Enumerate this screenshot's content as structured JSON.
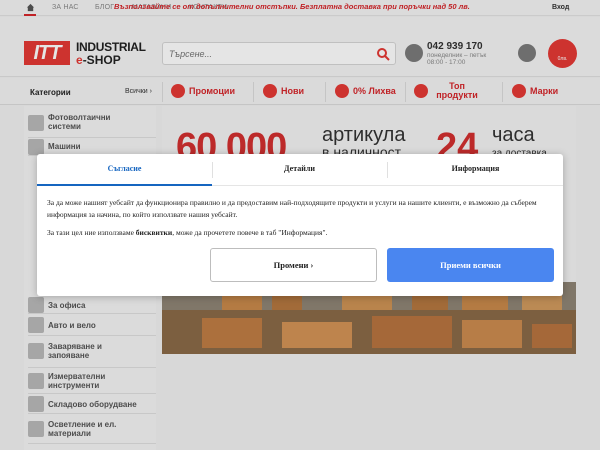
{
  "topbar": {
    "nav": [
      "ЗА НАС",
      "БЛОГ",
      "МАГАЗИНИ",
      "КОНТАКТИ"
    ],
    "promo": "Възползвайте се от допълнителни отстъпки. Безплатна доставка при поръчки над 50 лв.",
    "login": "Вход"
  },
  "header": {
    "logo_mark": "ITT",
    "logo_line1": "INDUSTRIAL",
    "logo_line2_e": "e",
    "logo_line2_rest": "-SHOP",
    "search_placeholder": "Търсене...",
    "phone": "042 939 170",
    "phone_days": "понеделник – петък",
    "phone_hours": "08:00 - 17:00",
    "cart_label": "0лв."
  },
  "catbar": {
    "title": "Категории",
    "all": "Всички ›",
    "items": [
      "Промоции",
      "Нови",
      "0% Лихва",
      "Топ продукти",
      "Марки"
    ]
  },
  "sidebar": {
    "items": [
      "Фотоволтаични системи",
      "Машини",
      "За офиса",
      "Авто и вело",
      "Заваряване и запояване",
      "Измервателни инструменти",
      "Складово оборудване",
      "Осветление и ел. материали"
    ]
  },
  "banner": {
    "number": "60 000",
    "line1": "артикула",
    "line2": "в наличност",
    "hours_num": "24",
    "hours_word": "часа",
    "hours_sub": "за доставка"
  },
  "modal": {
    "tabs": [
      "Съгласие",
      "Детайли",
      "Информация"
    ],
    "text1": "За да може нашият уебсайт да функционира правилно и да предоставим най-подходящите продукти и услуги на нашите клиенти, е възможно да съберем информация за начина, по който използвате нашия уебсайт.",
    "text2_a": "За тази цел ние използваме ",
    "text2_b": "бисквитки",
    "text2_c": ", може да прочетете повече в таб \"Информация\".",
    "customize": "Промени ›",
    "accept": "Приеми всички"
  },
  "colors": {
    "brand_red": "#e53935",
    "accept_blue": "#4a86f0",
    "tab_active": "#1565c0"
  }
}
